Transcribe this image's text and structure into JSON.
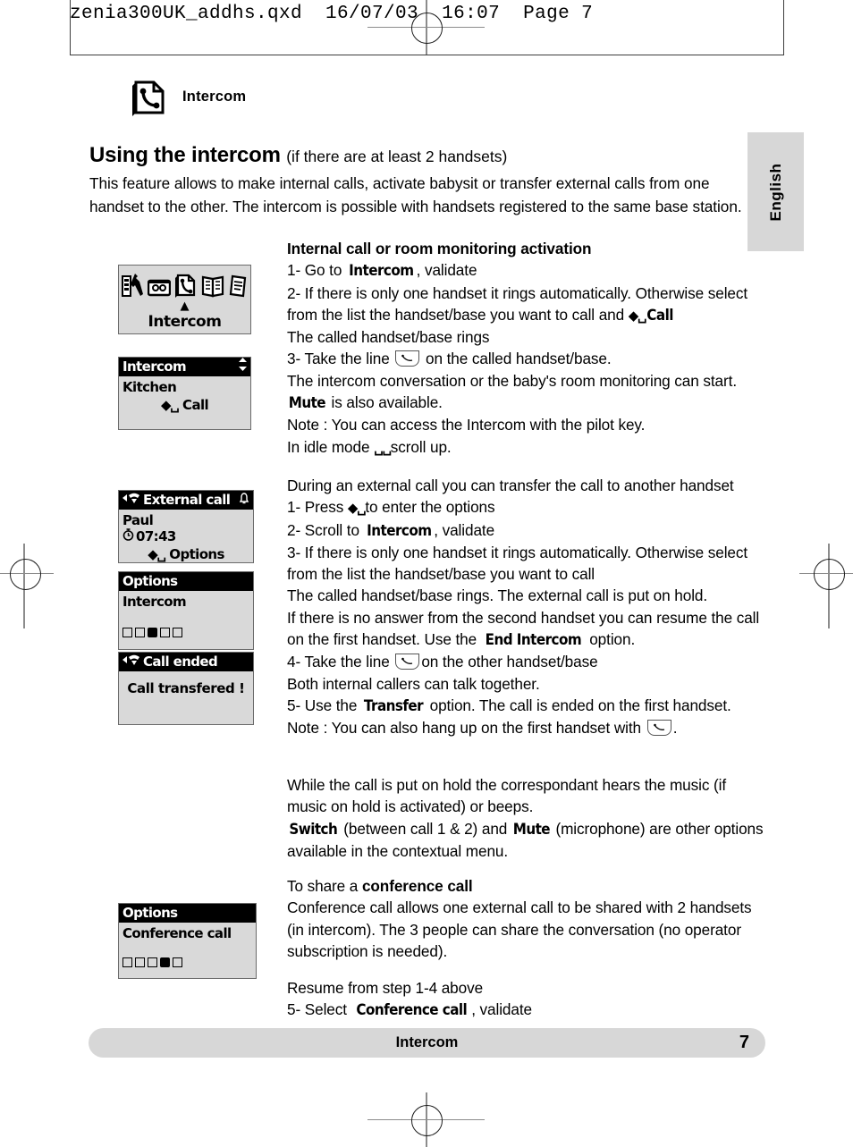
{
  "print_header": "zenia300UK_addhs.qxd  16/07/03  16:07  Page 7",
  "section": {
    "icon": "page-phone-icon",
    "label": "Intercom"
  },
  "language_tab": "English",
  "title": {
    "main": "Using the intercom",
    "sub": "(if there are at least 2 handsets)"
  },
  "intro": "This feature allows to make internal calls, activate babysit or transfer external calls from one handset to the other. The intercom is possible with handsets registered to the same base station.",
  "block1": {
    "heading": "Internal call or room monitoring activation",
    "l1_a": "1- Go to ",
    "l1_lcd": "Intercom",
    "l1_b": ", validate",
    "l2": "2- If there is only one handset it rings automatically. Otherwise select from the list the handset/base you want to call and ",
    "l2_lcd": "Call",
    "l3": "The called handset/base rings",
    "l4_a": "3- Take the line ",
    "l4_b": " on the called handset/base.",
    "l5": "The intercom conversation or the baby's room monitoring can start.",
    "l6_lcd": "Mute",
    "l6_b": " is also available.",
    "l7": "Note : You can access the Intercom with the pilot key.",
    "l8_a": "In idle mode ",
    "l8_b": "scroll up."
  },
  "block2": {
    "l1": "During an external call you can transfer the call to another handset",
    "l2_a": "1- Press ",
    "l2_b": "to enter the options",
    "l3_a": "2- Scroll to ",
    "l3_lcd": "Intercom",
    "l3_b": ", validate",
    "l4": "3- If there is only one handset it rings automatically. Otherwise select from the list the handset/base you want to call",
    "l5": "The called handset/base rings. The external call is put on hold.",
    "l6_a": "If there is no answer from the second handset you can resume the call on the first handset. Use the ",
    "l6_lcd": "End  Intercom",
    "l6_b": " option.",
    "l7_a": "4- Take the line ",
    "l7_b": "on the other handset/base",
    "l8": "Both internal callers can talk together.",
    "l9_a": "5- Use the ",
    "l9_lcd": "Transfer",
    "l9_b": " option. The call is ended on the first handset.",
    "l10_a": "Note : You can also hang up on the first handset with ",
    "l10_b": "."
  },
  "block3": {
    "l1": "While the call is put on hold the correspondant hears the music (if music on hold is activated) or beeps.",
    "l2_lcd1": "Switch",
    "l2_a": " (between call 1 & 2) and ",
    "l2_lcd2": "Mute",
    "l2_b": " (microphone) are other options available in the contextual menu."
  },
  "block4": {
    "l1_a": "To share a ",
    "l1_bold": "conference call",
    "l2": "Conference call allows one external call to be shared with 2 handsets (in intercom). The 3 people can share the conversation (no operator subscription is needed).",
    "l3": "Resume from step 1-4 above",
    "l4_a": "5- Select ",
    "l4_lcd": "Conference  call",
    "l4_b": ", validate"
  },
  "screens": {
    "menu": {
      "caption": "Intercom",
      "icons": [
        "settings-tools-icon",
        "answering-machine-icon",
        "intercom-page-phone-icon",
        "phonebook-icon",
        "notes-icon"
      ]
    },
    "intercom_list": {
      "title": "Intercom",
      "scroll_icon": "updown-arrows-icon",
      "item": "Kitchen",
      "softkey": "Call"
    },
    "external_call": {
      "title": "External call",
      "title_icon": "phone-offhook-icon",
      "right_icon": "bell-icon",
      "name": "Paul",
      "timer_icon": "stopwatch-icon",
      "timer": "07:43",
      "softkey": "Options"
    },
    "options_intercom": {
      "title": "Options",
      "item": "Intercom",
      "dots": 5,
      "active_dot": 3
    },
    "call_ended": {
      "title": "Call ended",
      "title_icon": "phone-offhook-icon",
      "message": "Call transfered !"
    },
    "options_conference": {
      "title": "Options",
      "item": "Conference call",
      "dots": 5,
      "active_dot": 4
    }
  },
  "footer": {
    "title": "Intercom",
    "page": "7"
  }
}
